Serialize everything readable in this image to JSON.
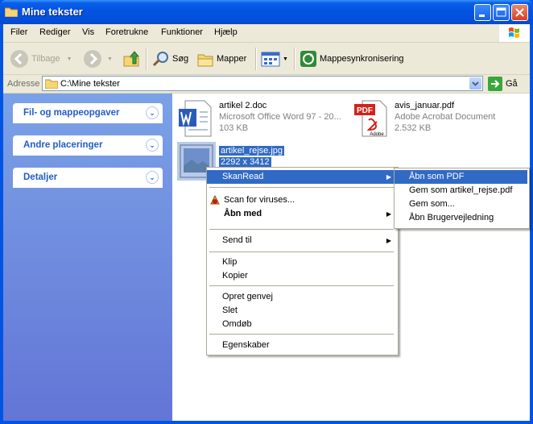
{
  "window": {
    "title": "Mine tekster"
  },
  "menubar": {
    "items": [
      "Filer",
      "Rediger",
      "Vis",
      "Foretrukne",
      "Funktioner",
      "Hjælp"
    ]
  },
  "toolbar": {
    "back_label": "Tilbage",
    "search_label": "Søg",
    "folders_label": "Mapper",
    "sync_label": "Mappesynkronisering"
  },
  "addressbar": {
    "label": "Adresse",
    "path": "C:\\Mine tekster",
    "go_label": "Gå"
  },
  "sidebar": {
    "panels": [
      {
        "title": "Fil- og mappeopgaver"
      },
      {
        "title": "Andre placeringer"
      },
      {
        "title": "Detaljer"
      }
    ]
  },
  "files": [
    {
      "name": "artikel 2.doc",
      "type": "Microsoft Office Word 97 - 20...",
      "size": "103 KB",
      "icon": "word-document-icon"
    },
    {
      "name": "avis_januar.pdf",
      "type": "Adobe Acrobat Document",
      "size": "2.532 KB",
      "icon": "pdf-document-icon",
      "icon_text": "PDF",
      "icon_brand": "Adobe"
    },
    {
      "name": "artikel_rejse.jpg",
      "dims": "2292 x 3412",
      "icon": "image-file-icon"
    }
  ],
  "context_menu": {
    "items": [
      {
        "label": "SkanRead",
        "submenu": true,
        "highlighted": true
      },
      {
        "label": "Scan for viruses...",
        "icon": "virus-scan-icon"
      },
      {
        "label": "Åbn med",
        "submenu": true,
        "bold": true
      },
      {
        "label": "Send til",
        "submenu": true
      },
      {
        "label": "Klip"
      },
      {
        "label": "Kopier"
      },
      {
        "label": "Opret genvej"
      },
      {
        "label": "Slet"
      },
      {
        "label": "Omdøb"
      },
      {
        "label": "Egenskaber"
      }
    ]
  },
  "submenu": {
    "items": [
      {
        "label": "Åbn som PDF",
        "highlighted": true
      },
      {
        "label": "Gem som artikel_rejse.pdf"
      },
      {
        "label": "Gem som..."
      },
      {
        "label": "Åbn Brugervejledning"
      }
    ]
  },
  "colors": {
    "highlight": "#316AC5",
    "titlebar": "#0553E1",
    "panel_title": "#215DC6"
  }
}
